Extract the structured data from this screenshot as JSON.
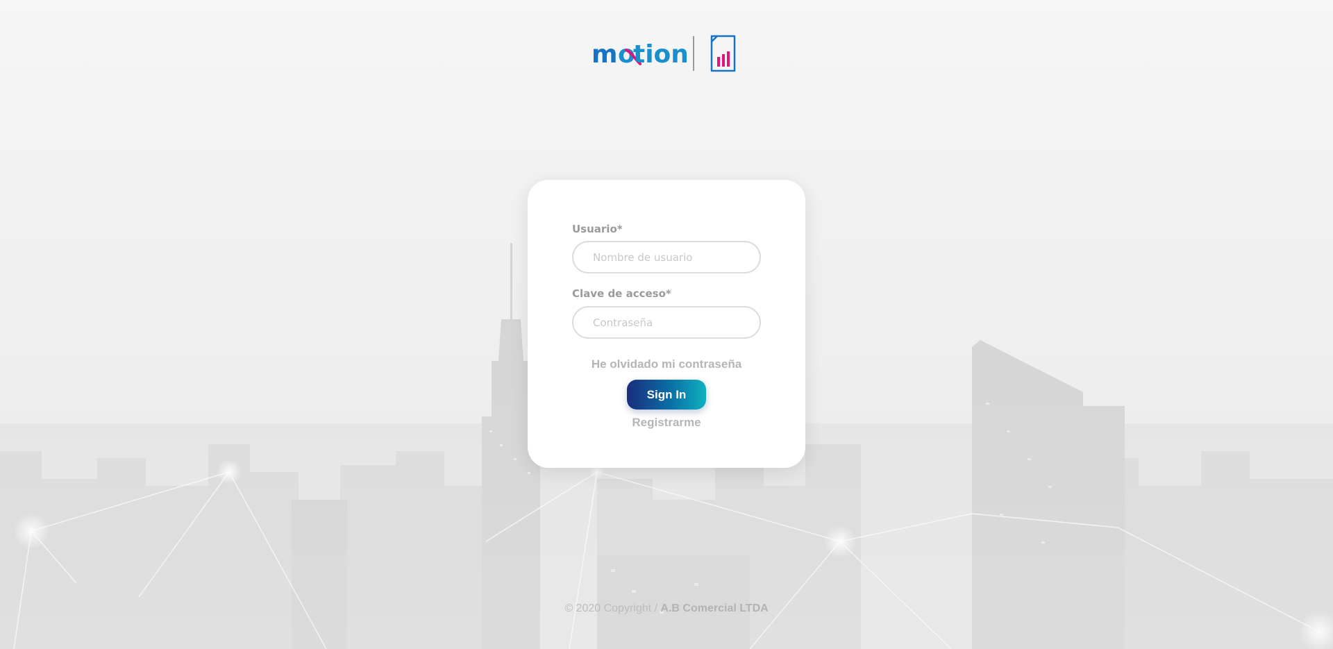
{
  "logo": {
    "brand_text": "motion",
    "colors": {
      "blue": "#1565c0",
      "cyan": "#1ea0d8",
      "magenta": "#e0167a",
      "divider": "#9a9a9a"
    },
    "sim_icon": "sim-card-signal-icon"
  },
  "login": {
    "username_label": "Usuario*",
    "username_placeholder": "Nombre de usuario",
    "username_value": "",
    "password_label": "Clave de acceso*",
    "password_placeholder": "Contraseña",
    "password_value": "",
    "forgot_label": "He olvidado mi contraseña",
    "signin_label": "Sign In",
    "register_label": "Registrarme",
    "accent_gradient": [
      "#1a2d7e",
      "#0fb1be"
    ]
  },
  "footer": {
    "copyright_prefix": "© 2020 Copyright / ",
    "company": "A.B Comercial LTDA"
  },
  "background": {
    "description_icon": "city-skyline-network-background"
  }
}
